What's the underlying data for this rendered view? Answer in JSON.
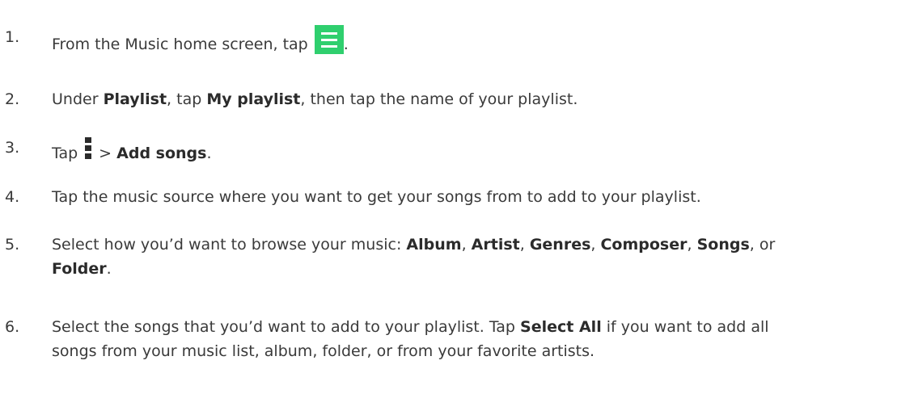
{
  "steps": [
    {
      "num": "1.",
      "t1": "From the Music home screen, tap",
      "t2": "."
    },
    {
      "num": "2.",
      "t1": "Under ",
      "b1": "Playlist",
      "t2": ", tap ",
      "b2": "My playlist",
      "t3": ", then tap the name of your playlist."
    },
    {
      "num": "3.",
      "t1": "Tap",
      "t2": "> ",
      "b1": "Add songs",
      "t3": "."
    },
    {
      "num": "4.",
      "t1": "Tap the music source where you want to get your songs from to add to your playlist."
    },
    {
      "num": "5.",
      "t1": "Select how you’d want to browse your music: ",
      "b1": "Album",
      "c1": ", ",
      "b2": "Artist",
      "c2": ", ",
      "b3": "Genres",
      "c3": ", ",
      "b4": "Composer",
      "c4": ", ",
      "b5": "Songs",
      "c5": ", or",
      "b6": "Folder",
      "c6": "."
    },
    {
      "num": "6.",
      "t1": "Select the songs that you’d want to add to your playlist. Tap ",
      "b1": "Select All",
      "t2": " if you want to add all",
      "line2": "songs from your music list, album, folder, or from your favorite artists."
    }
  ],
  "icons": {
    "menu_icon": "hamburger-menu-icon",
    "menu_icon_color": "#2fcf6e",
    "overflow_icon": "more-vertical-icon"
  }
}
